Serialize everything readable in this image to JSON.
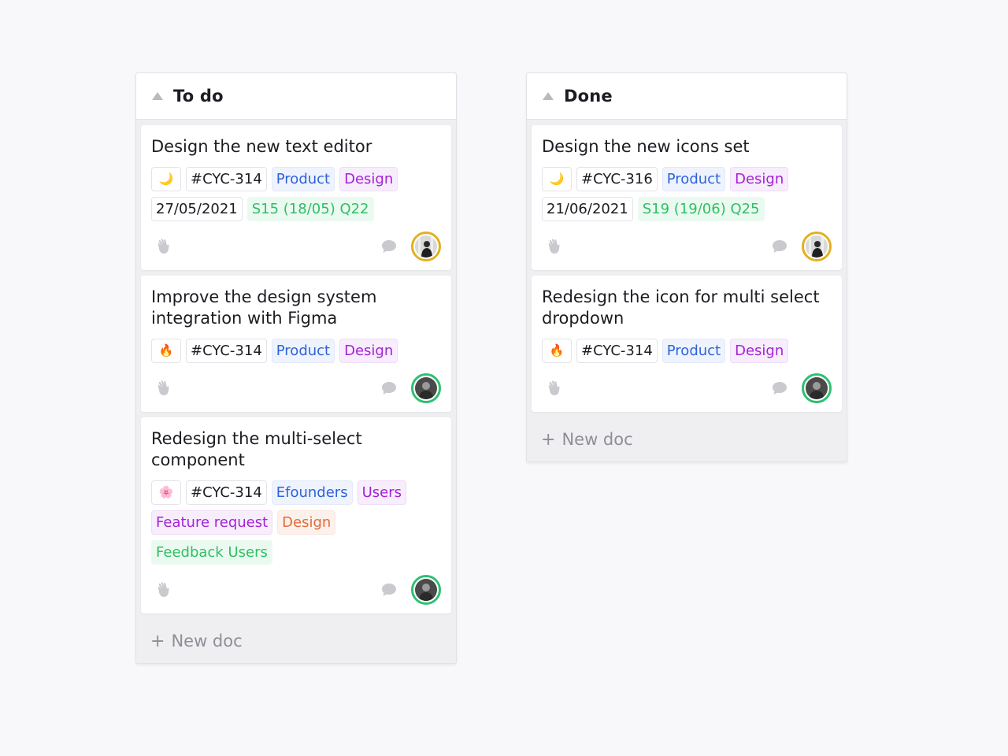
{
  "columns": [
    {
      "title": "To do",
      "new_doc_label": "New doc",
      "cards": [
        {
          "title": "Design the new text editor",
          "emoji": "🌙",
          "id": "#CYC-314",
          "tags": [
            {
              "label": "Product",
              "color": "blue"
            },
            {
              "label": "Design",
              "color": "purple"
            }
          ],
          "date": "27/05/2021",
          "sprint": "S15 (18/05) Q22",
          "avatar_ring": "yellow"
        },
        {
          "title": "Improve the design system integration with Figma",
          "emoji": "🔥",
          "id": "#CYC-314",
          "tags": [
            {
              "label": "Product",
              "color": "blue"
            },
            {
              "label": "Design",
              "color": "purple"
            }
          ],
          "avatar_ring": "green"
        },
        {
          "title": "Redesign the multi-select component",
          "emoji": "🌸",
          "id": "#CYC-314",
          "tags": [
            {
              "label": "Efounders",
              "color": "blue"
            },
            {
              "label": "Users",
              "color": "purple"
            },
            {
              "label": "Feature request",
              "color": "purple"
            },
            {
              "label": "Design",
              "color": "orange"
            },
            {
              "label": "Feedback Users",
              "color": "green"
            }
          ],
          "avatar_ring": "green"
        }
      ]
    },
    {
      "title": "Done",
      "new_doc_label": "New doc",
      "cards": [
        {
          "title": "Design the new icons set",
          "emoji": "🌙",
          "id": "#CYC-316",
          "tags": [
            {
              "label": "Product",
              "color": "blue"
            },
            {
              "label": "Design",
              "color": "purple"
            }
          ],
          "date": "21/06/2021",
          "sprint": "S19 (19/06) Q25",
          "avatar_ring": "yellow"
        },
        {
          "title": "Redesign the icon for multi select dropdown",
          "emoji": "🔥",
          "id": "#CYC-314",
          "tags": [
            {
              "label": "Product",
              "color": "blue"
            },
            {
              "label": "Design",
              "color": "purple"
            }
          ],
          "avatar_ring": "green"
        }
      ]
    }
  ],
  "icons": {
    "collapse": "triangle-up-icon",
    "react": "waving-hand-icon",
    "comment": "speech-bubble-icon",
    "plus": "plus-icon"
  },
  "colors": {
    "blue": "#2e63d8",
    "purple": "#a323d3",
    "green": "#2fbf64",
    "orange": "#e46a3a",
    "avatar_yellow": "#e2b021",
    "avatar_green": "#2fbf73"
  }
}
